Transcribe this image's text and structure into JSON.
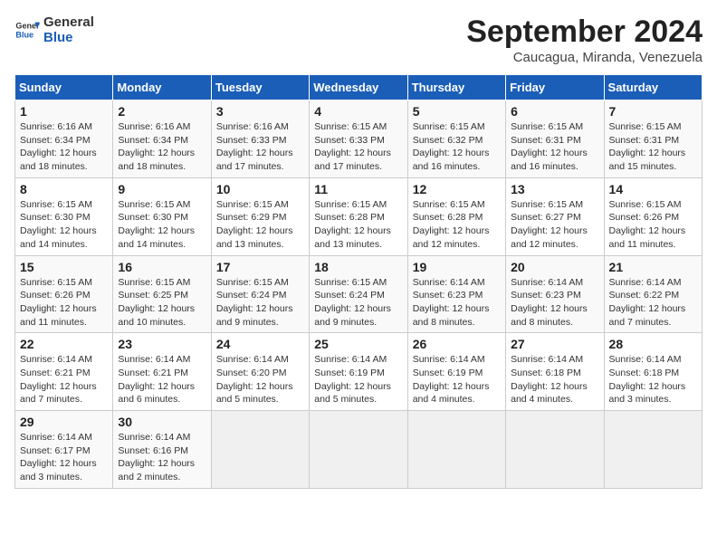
{
  "header": {
    "logo_line1": "General",
    "logo_line2": "Blue",
    "title": "September 2024",
    "subtitle": "Caucagua, Miranda, Venezuela"
  },
  "days_of_week": [
    "Sunday",
    "Monday",
    "Tuesday",
    "Wednesday",
    "Thursday",
    "Friday",
    "Saturday"
  ],
  "weeks": [
    [
      {
        "day": "1",
        "rise": "Sunrise: 6:16 AM",
        "set": "Sunset: 6:34 PM",
        "daylight": "Daylight: 12 hours and 18 minutes."
      },
      {
        "day": "2",
        "rise": "Sunrise: 6:16 AM",
        "set": "Sunset: 6:34 PM",
        "daylight": "Daylight: 12 hours and 18 minutes."
      },
      {
        "day": "3",
        "rise": "Sunrise: 6:16 AM",
        "set": "Sunset: 6:33 PM",
        "daylight": "Daylight: 12 hours and 17 minutes."
      },
      {
        "day": "4",
        "rise": "Sunrise: 6:15 AM",
        "set": "Sunset: 6:33 PM",
        "daylight": "Daylight: 12 hours and 17 minutes."
      },
      {
        "day": "5",
        "rise": "Sunrise: 6:15 AM",
        "set": "Sunset: 6:32 PM",
        "daylight": "Daylight: 12 hours and 16 minutes."
      },
      {
        "day": "6",
        "rise": "Sunrise: 6:15 AM",
        "set": "Sunset: 6:31 PM",
        "daylight": "Daylight: 12 hours and 16 minutes."
      },
      {
        "day": "7",
        "rise": "Sunrise: 6:15 AM",
        "set": "Sunset: 6:31 PM",
        "daylight": "Daylight: 12 hours and 15 minutes."
      }
    ],
    [
      {
        "day": "8",
        "rise": "Sunrise: 6:15 AM",
        "set": "Sunset: 6:30 PM",
        "daylight": "Daylight: 12 hours and 14 minutes."
      },
      {
        "day": "9",
        "rise": "Sunrise: 6:15 AM",
        "set": "Sunset: 6:30 PM",
        "daylight": "Daylight: 12 hours and 14 minutes."
      },
      {
        "day": "10",
        "rise": "Sunrise: 6:15 AM",
        "set": "Sunset: 6:29 PM",
        "daylight": "Daylight: 12 hours and 13 minutes."
      },
      {
        "day": "11",
        "rise": "Sunrise: 6:15 AM",
        "set": "Sunset: 6:28 PM",
        "daylight": "Daylight: 12 hours and 13 minutes."
      },
      {
        "day": "12",
        "rise": "Sunrise: 6:15 AM",
        "set": "Sunset: 6:28 PM",
        "daylight": "Daylight: 12 hours and 12 minutes."
      },
      {
        "day": "13",
        "rise": "Sunrise: 6:15 AM",
        "set": "Sunset: 6:27 PM",
        "daylight": "Daylight: 12 hours and 12 minutes."
      },
      {
        "day": "14",
        "rise": "Sunrise: 6:15 AM",
        "set": "Sunset: 6:26 PM",
        "daylight": "Daylight: 12 hours and 11 minutes."
      }
    ],
    [
      {
        "day": "15",
        "rise": "Sunrise: 6:15 AM",
        "set": "Sunset: 6:26 PM",
        "daylight": "Daylight: 12 hours and 11 minutes."
      },
      {
        "day": "16",
        "rise": "Sunrise: 6:15 AM",
        "set": "Sunset: 6:25 PM",
        "daylight": "Daylight: 12 hours and 10 minutes."
      },
      {
        "day": "17",
        "rise": "Sunrise: 6:15 AM",
        "set": "Sunset: 6:24 PM",
        "daylight": "Daylight: 12 hours and 9 minutes."
      },
      {
        "day": "18",
        "rise": "Sunrise: 6:15 AM",
        "set": "Sunset: 6:24 PM",
        "daylight": "Daylight: 12 hours and 9 minutes."
      },
      {
        "day": "19",
        "rise": "Sunrise: 6:14 AM",
        "set": "Sunset: 6:23 PM",
        "daylight": "Daylight: 12 hours and 8 minutes."
      },
      {
        "day": "20",
        "rise": "Sunrise: 6:14 AM",
        "set": "Sunset: 6:23 PM",
        "daylight": "Daylight: 12 hours and 8 minutes."
      },
      {
        "day": "21",
        "rise": "Sunrise: 6:14 AM",
        "set": "Sunset: 6:22 PM",
        "daylight": "Daylight: 12 hours and 7 minutes."
      }
    ],
    [
      {
        "day": "22",
        "rise": "Sunrise: 6:14 AM",
        "set": "Sunset: 6:21 PM",
        "daylight": "Daylight: 12 hours and 7 minutes."
      },
      {
        "day": "23",
        "rise": "Sunrise: 6:14 AM",
        "set": "Sunset: 6:21 PM",
        "daylight": "Daylight: 12 hours and 6 minutes."
      },
      {
        "day": "24",
        "rise": "Sunrise: 6:14 AM",
        "set": "Sunset: 6:20 PM",
        "daylight": "Daylight: 12 hours and 5 minutes."
      },
      {
        "day": "25",
        "rise": "Sunrise: 6:14 AM",
        "set": "Sunset: 6:19 PM",
        "daylight": "Daylight: 12 hours and 5 minutes."
      },
      {
        "day": "26",
        "rise": "Sunrise: 6:14 AM",
        "set": "Sunset: 6:19 PM",
        "daylight": "Daylight: 12 hours and 4 minutes."
      },
      {
        "day": "27",
        "rise": "Sunrise: 6:14 AM",
        "set": "Sunset: 6:18 PM",
        "daylight": "Daylight: 12 hours and 4 minutes."
      },
      {
        "day": "28",
        "rise": "Sunrise: 6:14 AM",
        "set": "Sunset: 6:18 PM",
        "daylight": "Daylight: 12 hours and 3 minutes."
      }
    ],
    [
      {
        "day": "29",
        "rise": "Sunrise: 6:14 AM",
        "set": "Sunset: 6:17 PM",
        "daylight": "Daylight: 12 hours and 3 minutes."
      },
      {
        "day": "30",
        "rise": "Sunrise: 6:14 AM",
        "set": "Sunset: 6:16 PM",
        "daylight": "Daylight: 12 hours and 2 minutes."
      },
      null,
      null,
      null,
      null,
      null
    ]
  ]
}
